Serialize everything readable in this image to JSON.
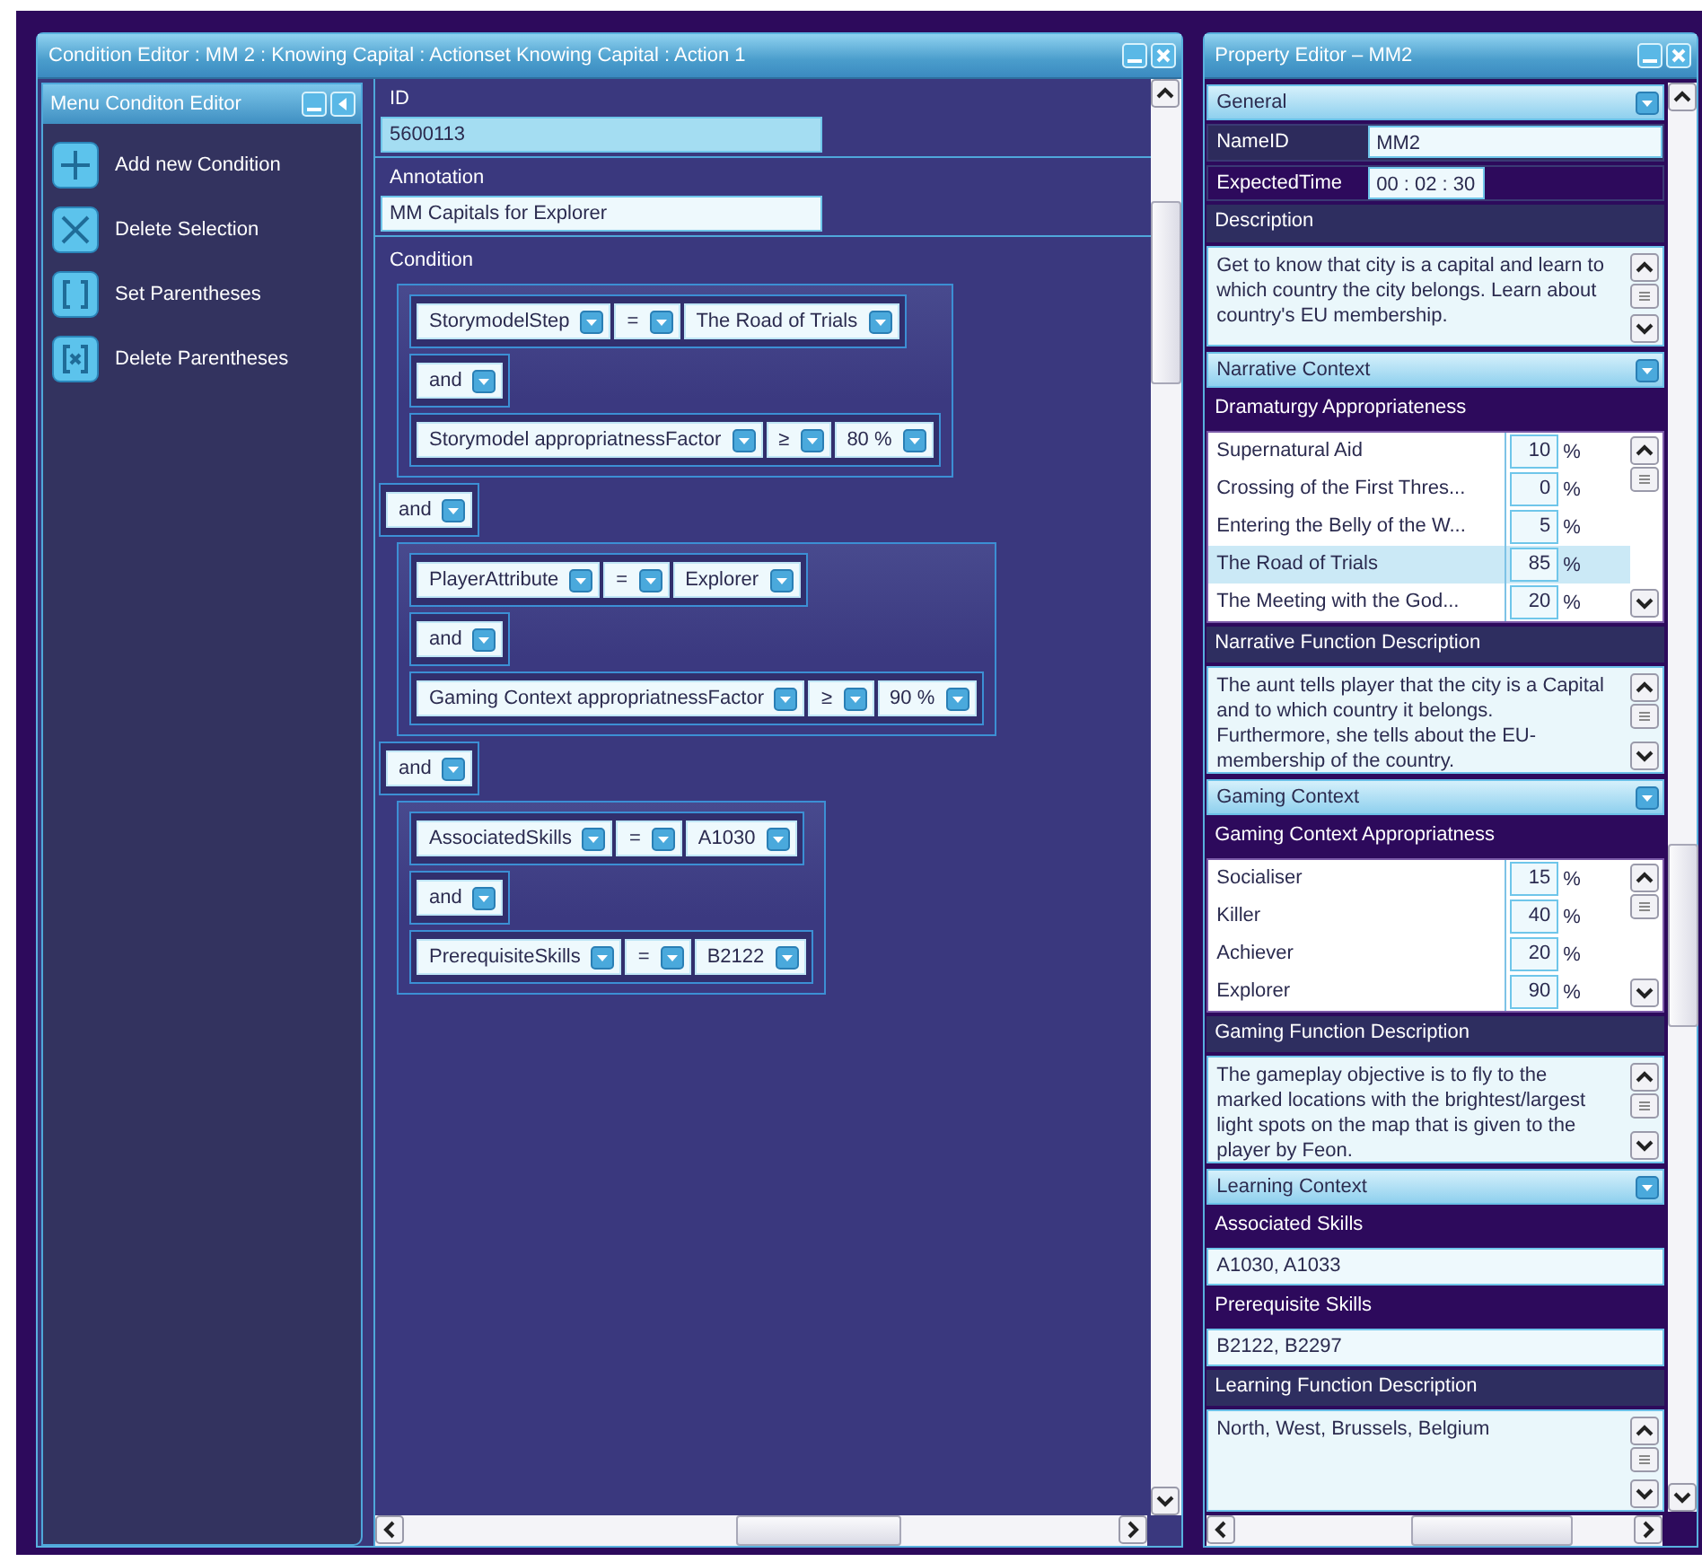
{
  "condition_editor": {
    "title": "Condition Editor : MM 2 : Knowing Capital : Actionset Knowing Capital : Action 1",
    "menu": {
      "title": "Menu Conditon Editor",
      "items": [
        {
          "kind": "add",
          "label": "Add new Condition"
        },
        {
          "kind": "delete",
          "label": "Delete Selection"
        },
        {
          "kind": "parentheses",
          "label": "Set Parentheses"
        },
        {
          "kind": "remove_parentheses",
          "label": "Delete Parentheses"
        }
      ]
    },
    "fields": [
      {
        "label": "ID",
        "value": "5600113",
        "focused": true
      },
      {
        "label": "Annotation",
        "value": "MM Capitals for Explorer",
        "focused": false
      }
    ],
    "condition": {
      "label": "Condition",
      "items": [
        {
          "kind": "group",
          "children": [
            {
              "kind": "clause",
              "field": "StorymodelStep",
              "operator": "=",
              "value": "The Road of Trials"
            },
            {
              "kind": "connective",
              "value": "and"
            },
            {
              "kind": "clause",
              "field": "Storymodel appropriatnessFactor",
              "operator": "≥",
              "value": "80 %"
            }
          ]
        },
        {
          "kind": "connective",
          "value": "and"
        },
        {
          "kind": "group",
          "children": [
            {
              "kind": "clause",
              "field": "PlayerAttribute",
              "operator": "=",
              "value": "Explorer"
            },
            {
              "kind": "connective",
              "value": "and"
            },
            {
              "kind": "clause",
              "field": "Gaming Context appropriatnessFactor",
              "operator": "≥",
              "value": "90 %"
            }
          ]
        },
        {
          "kind": "connective",
          "value": "and"
        },
        {
          "kind": "group",
          "children": [
            {
              "kind": "clause",
              "field": "AssociatedSkills",
              "operator": "=",
              "value": "A1030"
            },
            {
              "kind": "connective",
              "value": "and"
            },
            {
              "kind": "clause",
              "field": "PrerequisiteSkills",
              "operator": "=",
              "value": "B2122"
            }
          ]
        }
      ]
    }
  },
  "property_editor": {
    "title": "Property Editor – MM2",
    "sections": [
      {
        "title": "General",
        "blocks": [
          {
            "kind": "field",
            "label": "NameID",
            "value": "MM2"
          },
          {
            "kind": "field_short",
            "label": "ExpectedTime",
            "value": "00 : 02 : 30"
          },
          {
            "kind": "caption",
            "label": "Description"
          },
          {
            "kind": "textarea",
            "text": "Get to know that city is a capital and learn to which country the city belongs. Learn about country's EU membership."
          }
        ]
      },
      {
        "title": "Narrative Context",
        "blocks": [
          {
            "kind": "heading",
            "label": "Dramaturgy Appropriateness"
          },
          {
            "kind": "percent_list",
            "rows": [
              {
                "label": "Supernatural Aid",
                "value": "10",
                "unit": "%",
                "selected": false
              },
              {
                "label": "Crossing of the First Thres...",
                "value": "0",
                "unit": "%",
                "selected": false
              },
              {
                "label": "Entering the Belly of the W...",
                "value": "5",
                "unit": "%",
                "selected": false
              },
              {
                "label": "The Road of Trials",
                "value": "85",
                "unit": "%",
                "selected": true
              },
              {
                "label": "The Meeting with the God...",
                "value": "20",
                "unit": "%",
                "selected": false
              }
            ]
          },
          {
            "kind": "caption",
            "label": "Narrative Function Description"
          },
          {
            "kind": "textarea",
            "text": "The aunt tells player that the city is a Capital and to which country it belongs. Furthermore, she tells about the EU-membership of the country."
          }
        ]
      },
      {
        "title": "Gaming Context",
        "blocks": [
          {
            "kind": "heading",
            "label": "Gaming Context Appropriatness"
          },
          {
            "kind": "percent_list",
            "rows": [
              {
                "label": "Socialiser",
                "value": "15",
                "unit": "%",
                "selected": false
              },
              {
                "label": "Killer",
                "value": "40",
                "unit": "%",
                "selected": false
              },
              {
                "label": "Achiever",
                "value": "20",
                "unit": "%",
                "selected": false
              },
              {
                "label": "Explorer",
                "value": "90",
                "unit": "%",
                "selected": false
              }
            ]
          },
          {
            "kind": "caption",
            "label": "Gaming Function Description"
          },
          {
            "kind": "textarea",
            "text": "The gameplay objective is to fly to the marked locations with the brightest/largest light spots on the map that is given to the player by Feon."
          }
        ]
      },
      {
        "title": "Learning Context",
        "blocks": [
          {
            "kind": "heading",
            "label": "Associated Skills"
          },
          {
            "kind": "input",
            "value": "A1030, A1033"
          },
          {
            "kind": "heading",
            "label": "Prerequisite Skills"
          },
          {
            "kind": "input",
            "value": "B2122, B2297"
          },
          {
            "kind": "caption",
            "label": "Learning Function Description"
          },
          {
            "kind": "textarea",
            "text": "North, West, Brussels, Belgium"
          }
        ]
      }
    ]
  }
}
